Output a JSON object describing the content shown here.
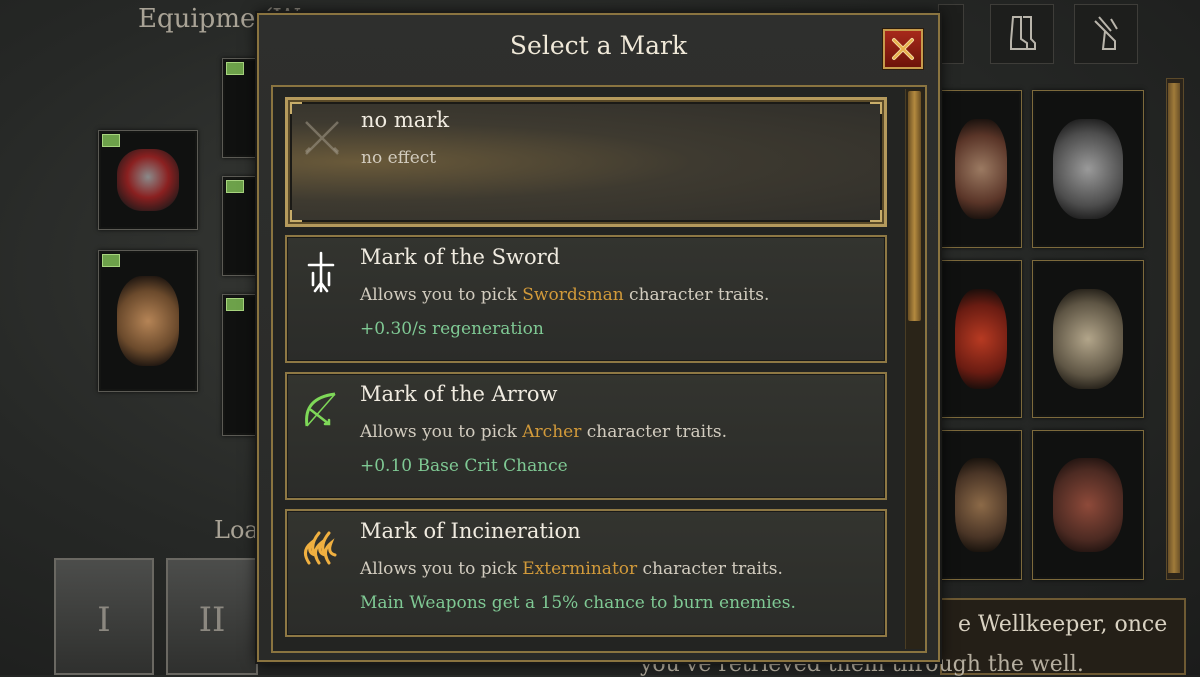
{
  "background": {
    "equipment_title": "Equipme",
    "equipment_title_paren": "(W",
    "loadout_label": "Loa",
    "loadout_buttons": [
      "I",
      "II"
    ],
    "info_line_1": "e Wellkeeper, once",
    "info_line_2": "you've retrieved them through the well."
  },
  "modal": {
    "title": "Select a Mark",
    "close_icon": "close-x-icon",
    "marks": [
      {
        "name": "no mark",
        "desc_plain": "no effect",
        "icon": "crossed-swords-faded-icon",
        "selected": true
      },
      {
        "name": "Mark of the Sword",
        "desc_before": "Allows you to pick ",
        "trait": "Swordsman",
        "desc_after": " character traits.",
        "bonus": "+0.30/s regeneration",
        "icon": "sword-mark-icon",
        "icon_color": "#ffffff"
      },
      {
        "name": "Mark of the Arrow",
        "desc_before": "Allows you to pick ",
        "trait": "Archer",
        "desc_after": " character traits.",
        "bonus": "+0.10 Base Crit Chance",
        "icon": "bow-mark-icon",
        "icon_color": "#7ed858"
      },
      {
        "name": "Mark of Incineration",
        "desc_before": "Allows you to pick ",
        "trait": "Exterminator",
        "desc_after": " character traits.",
        "bonus": "Main Weapons get a 15% chance to burn enemies.",
        "icon": "flame-mark-icon",
        "icon_color": "#f0b040"
      }
    ]
  },
  "colors": {
    "gold_border": "#8e7844",
    "trait_highlight": "#d29a3a",
    "bonus_green": "#7fc994"
  }
}
